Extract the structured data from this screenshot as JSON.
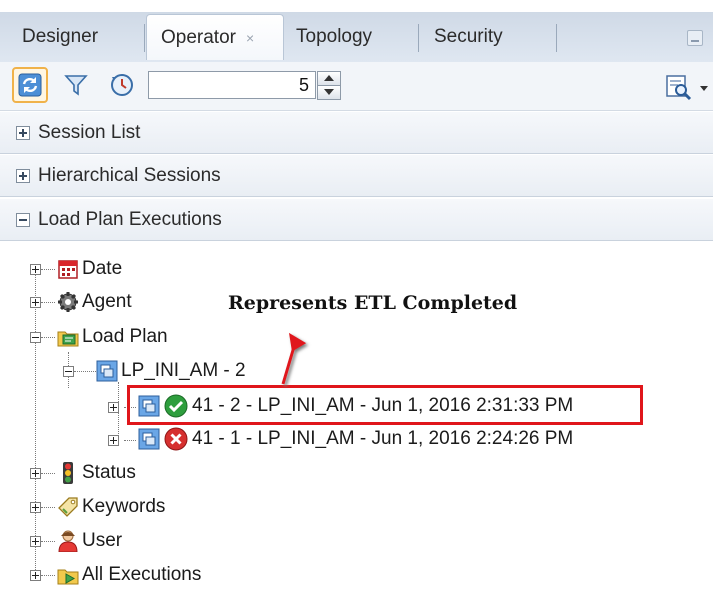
{
  "tabs": [
    {
      "label": "Designer",
      "active": false
    },
    {
      "label": "Operator",
      "active": true,
      "close": "×"
    },
    {
      "label": "Topology",
      "active": false
    },
    {
      "label": "Security",
      "active": false
    }
  ],
  "toolbar": {
    "refresh_interval_value": "5"
  },
  "accordions": [
    {
      "label": "Session List",
      "expanded": false
    },
    {
      "label": "Hierarchical Sessions",
      "expanded": false
    },
    {
      "label": "Load Plan Executions",
      "expanded": true
    }
  ],
  "tree": {
    "date": "Date",
    "agent": "Agent",
    "load_plan": "Load Plan",
    "lp_instance": "LP_INI_AM - 2",
    "exec_completed": "41 - 2 - LP_INI_AM - Jun 1, 2016 2:31:33 PM",
    "exec_failed": "41 - 1 - LP_INI_AM - Jun 1, 2016 2:24:26 PM",
    "status": "Status",
    "keywords": "Keywords",
    "user": "User",
    "all_executions": "All Executions"
  },
  "annotation": {
    "text": "Represents ETL Completed",
    "color": "#e0161b"
  }
}
